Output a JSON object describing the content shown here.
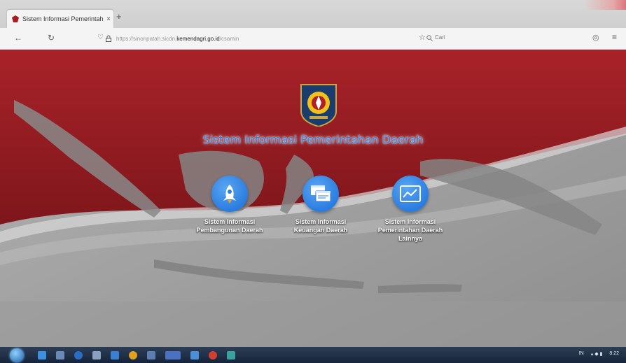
{
  "browser": {
    "tab_title": "Sistem Informasi Pemerintah",
    "close_glyph": "×",
    "new_tab_glyph": "+",
    "url_host": "https://sinonpatah.sicdn.",
    "url_domain": "kemendagri.go.id",
    "url_path": "/csamin",
    "search_placeholder": "Cari"
  },
  "page": {
    "title": "Sistem Informasi Pemerintahan Daerah",
    "menu": [
      {
        "line1": "Sistem Informasi",
        "line2": "Pembangunan Daerah",
        "line3": "",
        "icon": "rocket-icon"
      },
      {
        "line1": "Sistem Informasi",
        "line2": "Keuangan Daerah",
        "line3": "",
        "icon": "windows-icon"
      },
      {
        "line1": "Sistem Informasi",
        "line2": "Pemerintahan Daerah",
        "line3": "Lainnya",
        "icon": "chart-icon"
      }
    ]
  },
  "taskbar": {
    "tray_lang": "IN",
    "clock": "8:22"
  },
  "colors": {
    "banner_red": "#9b1f24",
    "accent_blue": "#2f86e0",
    "taskbar": "#1b2a40"
  }
}
